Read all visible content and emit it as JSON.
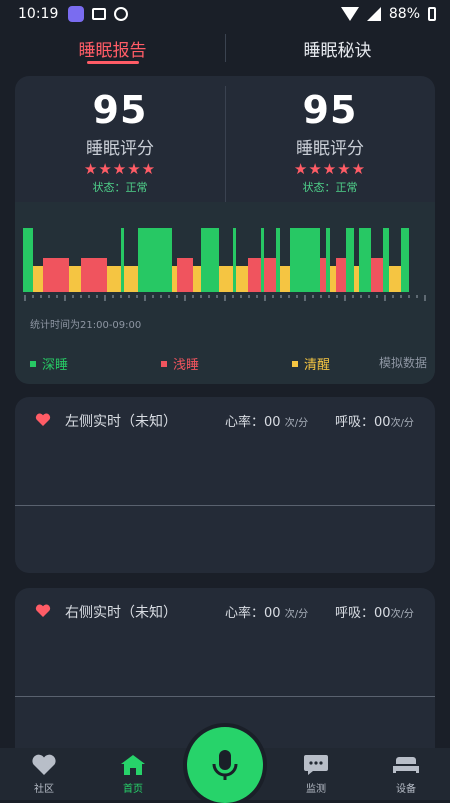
{
  "status_bar": {
    "time": "10:19",
    "battery": "88%"
  },
  "tabs": [
    {
      "label": "睡眠报告",
      "active": true
    },
    {
      "label": "睡眠秘诀",
      "active": false
    }
  ],
  "report": {
    "left": {
      "score": "95",
      "label": "睡眠评分",
      "stars": "★★★★★",
      "state": "状态：正常"
    },
    "right": {
      "score": "95",
      "label": "睡眠评分",
      "stars": "★★★★★",
      "state": "状态：正常"
    },
    "stat_time": "统计时间为21:00-09:00",
    "legend": [
      {
        "label": "深睡",
        "color": "#27c864"
      },
      {
        "label": "浅睡",
        "color": "#f0545e"
      },
      {
        "label": "清醒",
        "color": "#f5c542"
      }
    ],
    "mock_label": "模拟数据"
  },
  "chart_data": {
    "type": "bar",
    "series": [
      {
        "name": "深睡",
        "color": "#27c864"
      },
      {
        "name": "浅睡",
        "color": "#f0545e"
      },
      {
        "name": "清醒",
        "color": "#f5c542"
      }
    ]
  },
  "realtime": {
    "left": {
      "title": "左侧实时（未知）",
      "hr_label": "心率：",
      "hr_value": "00",
      "hr_unit": "次/分",
      "br_label": "呼吸：",
      "br_value": "00",
      "br_unit": "次/分"
    },
    "right": {
      "title": "右侧实时（未知）",
      "hr_label": "心率：",
      "hr_value": "00",
      "hr_unit": "次/分",
      "br_label": "呼吸：",
      "br_value": "00",
      "br_unit": "次/分"
    }
  },
  "nav": [
    {
      "label": "社区",
      "icon": "heart-icon",
      "active": false
    },
    {
      "label": "首页",
      "icon": "home-icon",
      "active": true
    },
    {
      "label": "",
      "icon": "mic-icon",
      "active": false
    },
    {
      "label": "监测",
      "icon": "chat-icon",
      "active": false
    },
    {
      "label": "设备",
      "icon": "bed-icon",
      "active": false
    }
  ],
  "colors": {
    "accent": "#ff5c66",
    "green": "#27d36a",
    "yellow": "#f5c542"
  }
}
